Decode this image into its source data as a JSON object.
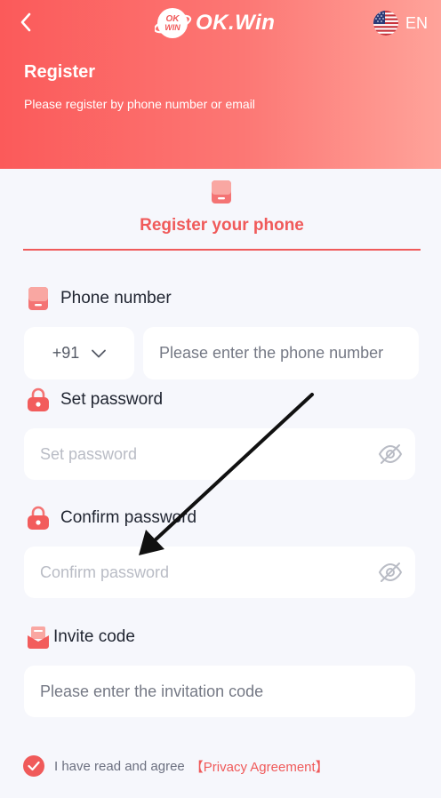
{
  "header": {
    "back_icon": "chevron-left-icon",
    "logo_text": "OK.Win",
    "logo_badge_text": "OK WIN",
    "language": {
      "flag_icon": "us-flag-icon",
      "label": "EN"
    },
    "title": "Register",
    "subtitle": "Please register by phone number or email"
  },
  "tab": {
    "icon": "phone-icon",
    "label": "Register your phone",
    "active": true
  },
  "form": {
    "phone": {
      "label": "Phone number",
      "icon": "phone-icon",
      "country_code": "+91",
      "placeholder": "Please enter the phone number",
      "value": ""
    },
    "password": {
      "label": "Set password",
      "icon": "lock-icon",
      "placeholder": "Set password",
      "value": ""
    },
    "confirm_password": {
      "label": "Confirm password",
      "icon": "lock-icon",
      "placeholder": "Confirm password",
      "value": ""
    },
    "invite_code": {
      "label": "Invite code",
      "icon": "invitation-icon",
      "placeholder": "Please enter the invitation code",
      "value": ""
    }
  },
  "agreement": {
    "checked": true,
    "text": "I have read and agree",
    "link_text": "【Privacy Agreement】"
  },
  "colors": {
    "accent": "#f05a5a",
    "header_gradient_start": "#fb5a5a",
    "header_gradient_end": "#ffa39a",
    "background": "#f6f7fc"
  }
}
